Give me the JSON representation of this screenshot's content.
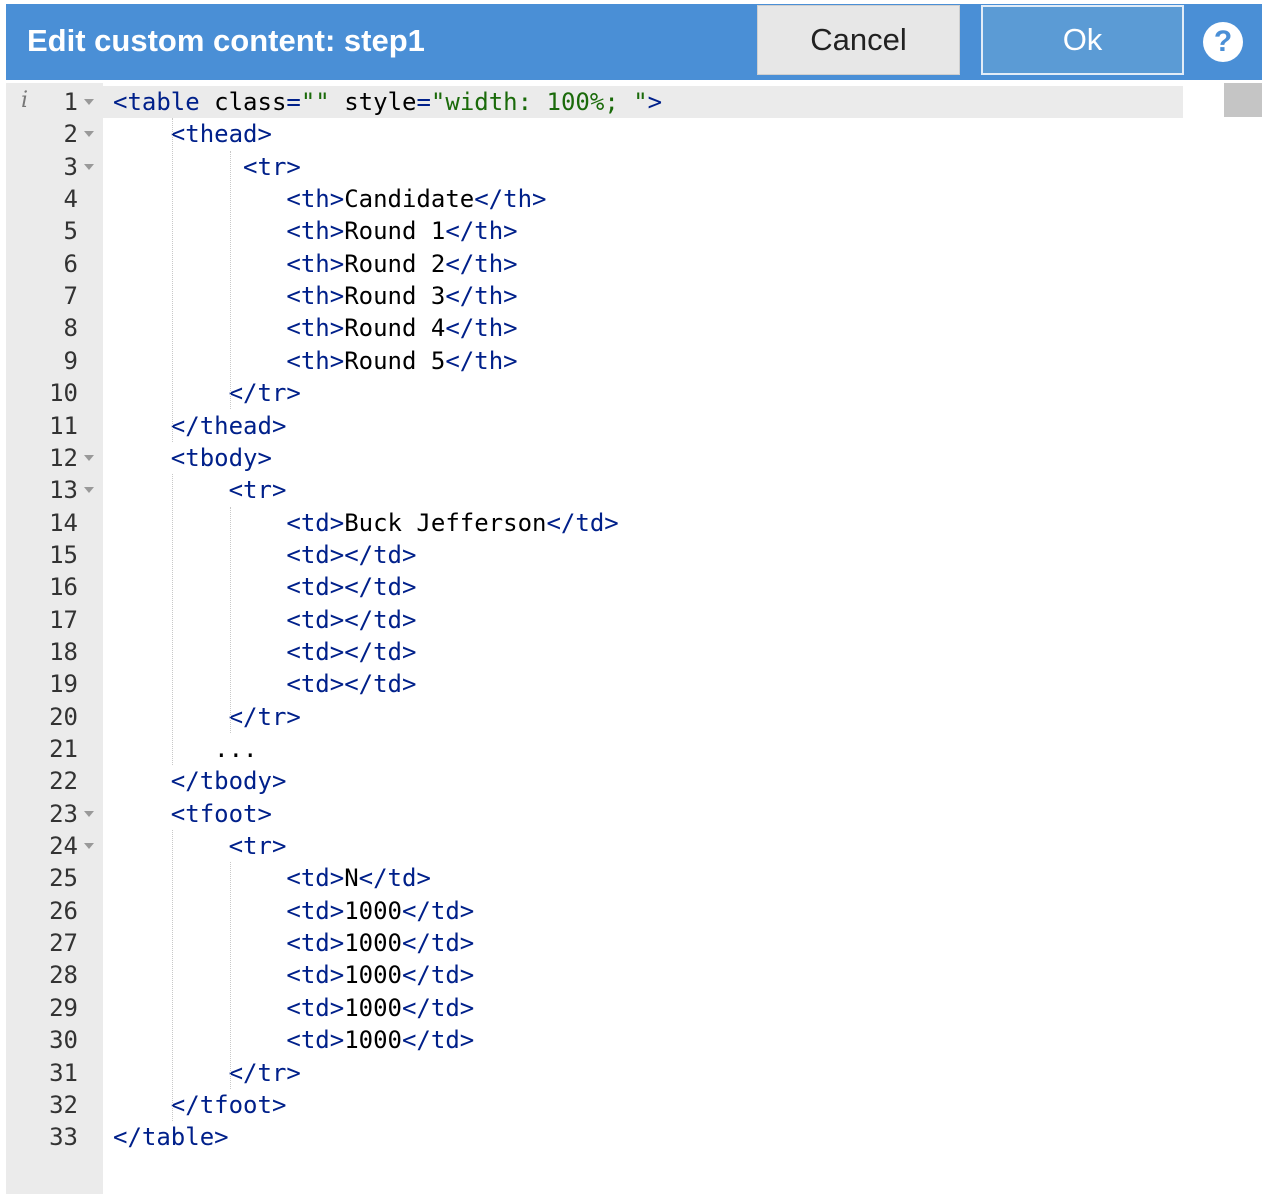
{
  "dialog": {
    "title": "Edit custom content: step1",
    "cancel_label": "Cancel",
    "ok_label": "Ok",
    "help_label": "?"
  },
  "editor": {
    "info_icon": "i",
    "lines": [
      {
        "n": "1",
        "fold": true,
        "indent": 0,
        "parts": [
          [
            "t",
            "<table "
          ],
          [
            "a",
            "class"
          ],
          [
            "t",
            "="
          ],
          [
            "v",
            "\"\""
          ],
          [
            "a",
            " style"
          ],
          [
            "t",
            "="
          ],
          [
            "v",
            "\"width: 100%; \""
          ],
          [
            "t",
            ">"
          ]
        ]
      },
      {
        "n": "2",
        "fold": true,
        "indent": 4,
        "parts": [
          [
            "t",
            "<thead>"
          ]
        ]
      },
      {
        "n": "3",
        "fold": true,
        "indent": 9,
        "parts": [
          [
            "t",
            "<tr>"
          ]
        ]
      },
      {
        "n": "4",
        "fold": false,
        "indent": 12,
        "parts": [
          [
            "t",
            "<th>"
          ],
          [
            "a",
            "Candidate"
          ],
          [
            "t",
            "</th>"
          ]
        ]
      },
      {
        "n": "5",
        "fold": false,
        "indent": 12,
        "parts": [
          [
            "t",
            "<th>"
          ],
          [
            "a",
            "Round 1"
          ],
          [
            "t",
            "</th>"
          ]
        ]
      },
      {
        "n": "6",
        "fold": false,
        "indent": 12,
        "parts": [
          [
            "t",
            "<th>"
          ],
          [
            "a",
            "Round 2"
          ],
          [
            "t",
            "</th>"
          ]
        ]
      },
      {
        "n": "7",
        "fold": false,
        "indent": 12,
        "parts": [
          [
            "t",
            "<th>"
          ],
          [
            "a",
            "Round 3"
          ],
          [
            "t",
            "</th>"
          ]
        ]
      },
      {
        "n": "8",
        "fold": false,
        "indent": 12,
        "parts": [
          [
            "t",
            "<th>"
          ],
          [
            "a",
            "Round 4"
          ],
          [
            "t",
            "</th>"
          ]
        ]
      },
      {
        "n": "9",
        "fold": false,
        "indent": 12,
        "parts": [
          [
            "t",
            "<th>"
          ],
          [
            "a",
            "Round 5"
          ],
          [
            "t",
            "</th>"
          ]
        ]
      },
      {
        "n": "10",
        "fold": false,
        "indent": 8,
        "parts": [
          [
            "t",
            "</tr>"
          ]
        ]
      },
      {
        "n": "11",
        "fold": false,
        "indent": 4,
        "parts": [
          [
            "t",
            "</thead>"
          ]
        ]
      },
      {
        "n": "12",
        "fold": true,
        "indent": 4,
        "parts": [
          [
            "t",
            "<tbody>"
          ]
        ]
      },
      {
        "n": "13",
        "fold": true,
        "indent": 8,
        "parts": [
          [
            "t",
            "<tr>"
          ]
        ]
      },
      {
        "n": "14",
        "fold": false,
        "indent": 12,
        "parts": [
          [
            "t",
            "<td>"
          ],
          [
            "a",
            "Buck Jefferson"
          ],
          [
            "t",
            "</td>"
          ]
        ]
      },
      {
        "n": "15",
        "fold": false,
        "indent": 12,
        "parts": [
          [
            "t",
            "<td></td>"
          ]
        ]
      },
      {
        "n": "16",
        "fold": false,
        "indent": 12,
        "parts": [
          [
            "t",
            "<td></td>"
          ]
        ]
      },
      {
        "n": "17",
        "fold": false,
        "indent": 12,
        "parts": [
          [
            "t",
            "<td></td>"
          ]
        ]
      },
      {
        "n": "18",
        "fold": false,
        "indent": 12,
        "parts": [
          [
            "t",
            "<td></td>"
          ]
        ]
      },
      {
        "n": "19",
        "fold": false,
        "indent": 12,
        "parts": [
          [
            "t",
            "<td></td>"
          ]
        ]
      },
      {
        "n": "20",
        "fold": false,
        "indent": 8,
        "parts": [
          [
            "t",
            "</tr>"
          ]
        ]
      },
      {
        "n": "21",
        "fold": false,
        "indent": 7,
        "parts": [
          [
            "a",
            "..."
          ]
        ]
      },
      {
        "n": "22",
        "fold": false,
        "indent": 4,
        "parts": [
          [
            "t",
            "</tbody>"
          ]
        ]
      },
      {
        "n": "23",
        "fold": true,
        "indent": 4,
        "parts": [
          [
            "t",
            "<tfoot>"
          ]
        ]
      },
      {
        "n": "24",
        "fold": true,
        "indent": 8,
        "parts": [
          [
            "t",
            "<tr>"
          ]
        ]
      },
      {
        "n": "25",
        "fold": false,
        "indent": 12,
        "parts": [
          [
            "t",
            "<td>"
          ],
          [
            "a",
            "N"
          ],
          [
            "t",
            "</td>"
          ]
        ]
      },
      {
        "n": "26",
        "fold": false,
        "indent": 12,
        "parts": [
          [
            "t",
            "<td>"
          ],
          [
            "a",
            "1000"
          ],
          [
            "t",
            "</td>"
          ]
        ]
      },
      {
        "n": "27",
        "fold": false,
        "indent": 12,
        "parts": [
          [
            "t",
            "<td>"
          ],
          [
            "a",
            "1000"
          ],
          [
            "t",
            "</td>"
          ]
        ]
      },
      {
        "n": "28",
        "fold": false,
        "indent": 12,
        "parts": [
          [
            "t",
            "<td>"
          ],
          [
            "a",
            "1000"
          ],
          [
            "t",
            "</td>"
          ]
        ]
      },
      {
        "n": "29",
        "fold": false,
        "indent": 12,
        "parts": [
          [
            "t",
            "<td>"
          ],
          [
            "a",
            "1000"
          ],
          [
            "t",
            "</td>"
          ]
        ]
      },
      {
        "n": "30",
        "fold": false,
        "indent": 12,
        "parts": [
          [
            "t",
            "<td>"
          ],
          [
            "a",
            "1000"
          ],
          [
            "t",
            "</td>"
          ]
        ]
      },
      {
        "n": "31",
        "fold": false,
        "indent": 8,
        "parts": [
          [
            "t",
            "</tr>"
          ]
        ]
      },
      {
        "n": "32",
        "fold": false,
        "indent": 4,
        "parts": [
          [
            "t",
            "</tfoot>"
          ]
        ]
      },
      {
        "n": "33",
        "fold": false,
        "indent": 0,
        "parts": [
          [
            "t",
            "</table>"
          ]
        ]
      }
    ]
  },
  "colors": {
    "header_bg": "#4a8fd6",
    "tag": "#00208a",
    "string": "#1a6a0a",
    "gutter_bg": "#ebebeb"
  }
}
